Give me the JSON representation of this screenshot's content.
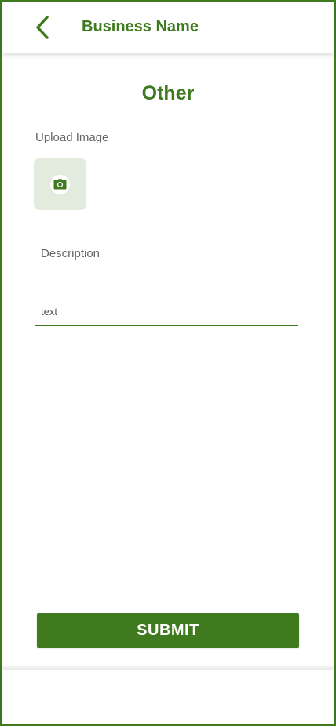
{
  "header": {
    "title": "Business Name",
    "back_icon": "chevron-left-icon"
  },
  "page": {
    "title": "Other"
  },
  "upload": {
    "label": "Upload Image",
    "icon": "camera-icon"
  },
  "description": {
    "label": "Description",
    "placeholder": "text",
    "value": ""
  },
  "actions": {
    "submit_label": "SUBMIT"
  },
  "colors": {
    "primary": "#3f7a1f",
    "upload_bg": "#e3eade",
    "label_text": "#666666"
  }
}
